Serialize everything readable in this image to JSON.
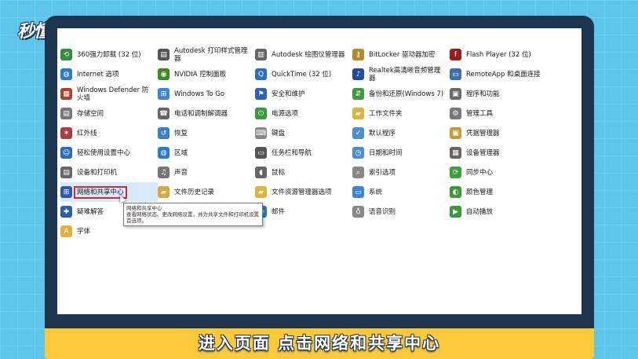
{
  "logo": {
    "text": "秒懂视频"
  },
  "caption": "进入页面 点击网络和共享中心",
  "tooltip": {
    "title": "网络和共享中心",
    "desc": "查看网络状态、更改网络设置，并为共享文件和打印机设置首选项。"
  },
  "colors": {
    "screen_bg": "#ffffff",
    "selected_border": "#d8282e",
    "caption_bg": "#fcc93a",
    "frame": "#1e3550"
  },
  "items": [
    {
      "label": "360强力卸载 (32 位)",
      "icon": "uninstall-icon",
      "color": "#2f8f3a"
    },
    {
      "label": "Autodesk 打印样式管理器",
      "icon": "printer-icon",
      "color": "#555555"
    },
    {
      "label": "Autodesk 绘图仪管理器",
      "icon": "plotter-icon",
      "color": "#666666"
    },
    {
      "label": "BitLocker 驱动器加密",
      "icon": "key-icon",
      "color": "#b58b2a"
    },
    {
      "label": "Flash Player (32 位)",
      "icon": "flash-icon",
      "color": "#9a1c1c"
    },
    {
      "label": "Internet 选项",
      "icon": "globe-icon",
      "color": "#2a7bd1"
    },
    {
      "label": "NVIDIA 控制面板",
      "icon": "nvidia-icon",
      "color": "#3d8b1d"
    },
    {
      "label": "QuickTime (32 位)",
      "icon": "quicktime-icon",
      "color": "#2b6cc4"
    },
    {
      "label": "Realtek高清晰音频管理器",
      "icon": "speaker-icon",
      "color": "#1f4e9c"
    },
    {
      "label": "RemoteApp 和桌面连接",
      "icon": "remote-icon",
      "color": "#3a6fb0"
    },
    {
      "label": "Windows Defender 防火墙",
      "icon": "firewall-icon",
      "color": "#a8442e"
    },
    {
      "label": "Windows To Go",
      "icon": "windows-icon",
      "color": "#3a86d6"
    },
    {
      "label": "安全和维护",
      "icon": "flag-icon",
      "color": "#2a63b8"
    },
    {
      "label": "备份和还原(Windows 7)",
      "icon": "backup-icon",
      "color": "#3f9a3f"
    },
    {
      "label": "程序和功能",
      "icon": "programs-icon",
      "color": "#6a6a6a"
    },
    {
      "label": "存储空间",
      "icon": "storage-icon",
      "color": "#777777"
    },
    {
      "label": "电话和调制解调器",
      "icon": "phone-icon",
      "color": "#666666"
    },
    {
      "label": "电源选项",
      "icon": "power-icon",
      "color": "#3a9a3a"
    },
    {
      "label": "工作文件夹",
      "icon": "folder-icon",
      "color": "#e2b13a"
    },
    {
      "label": "管理工具",
      "icon": "tools-icon",
      "color": "#777777"
    },
    {
      "label": "红外线",
      "icon": "infrared-icon",
      "color": "#b23a3a"
    },
    {
      "label": "恢复",
      "icon": "recovery-icon",
      "color": "#3a7fc9"
    },
    {
      "label": "键盘",
      "icon": "keyboard-icon",
      "color": "#888888"
    },
    {
      "label": "默认程序",
      "icon": "default-programs-icon",
      "color": "#4a8fd0"
    },
    {
      "label": "凭据管理器",
      "icon": "credential-icon",
      "color": "#c99a3a"
    },
    {
      "label": "轻松使用设置中心",
      "icon": "accessibility-icon",
      "color": "#2a6ac4"
    },
    {
      "label": "区域",
      "icon": "region-icon",
      "color": "#2a7bd1"
    },
    {
      "label": "任务栏和导航",
      "icon": "taskbar-icon",
      "color": "#555555"
    },
    {
      "label": "日期和时间",
      "icon": "clock-icon",
      "color": "#4a8fd0"
    },
    {
      "label": "设备管理器",
      "icon": "device-manager-icon",
      "color": "#666666"
    },
    {
      "label": "设备和打印机",
      "icon": "devices-printers-icon",
      "color": "#666666"
    },
    {
      "label": "声音",
      "icon": "sound-icon",
      "color": "#777777"
    },
    {
      "label": "鼠标",
      "icon": "mouse-icon",
      "color": "#666666"
    },
    {
      "label": "索引选项",
      "icon": "index-icon",
      "color": "#888888"
    },
    {
      "label": "同步中心",
      "icon": "sync-icon",
      "color": "#3aa03a"
    },
    {
      "label": "网络和共享中心",
      "icon": "network-icon",
      "color": "#2a5db0",
      "selected": true
    },
    {
      "label": "文件历史记录",
      "icon": "file-history-icon",
      "color": "#d9a83a"
    },
    {
      "label": "文件资源管理器选项",
      "icon": "explorer-options-icon",
      "color": "#e2b13a"
    },
    {
      "label": "系统",
      "icon": "system-icon",
      "color": "#3a86d6"
    },
    {
      "label": "颜色管理",
      "icon": "color-icon",
      "color": "#3a9a3a"
    },
    {
      "label": "疑难解答",
      "icon": "troubleshoot-icon",
      "color": "#2a5db0"
    },
    {
      "label": "",
      "icon": "",
      "color": ""
    },
    {
      "label": "邮件",
      "icon": "mail-icon",
      "color": "#2a7bd1"
    },
    {
      "label": "语音识别",
      "icon": "microphone-icon",
      "color": "#888888"
    },
    {
      "label": "自动播放",
      "icon": "autoplay-icon",
      "color": "#3a9a3a"
    },
    {
      "label": "字体",
      "icon": "font-icon",
      "color": "#e2b13a"
    }
  ]
}
